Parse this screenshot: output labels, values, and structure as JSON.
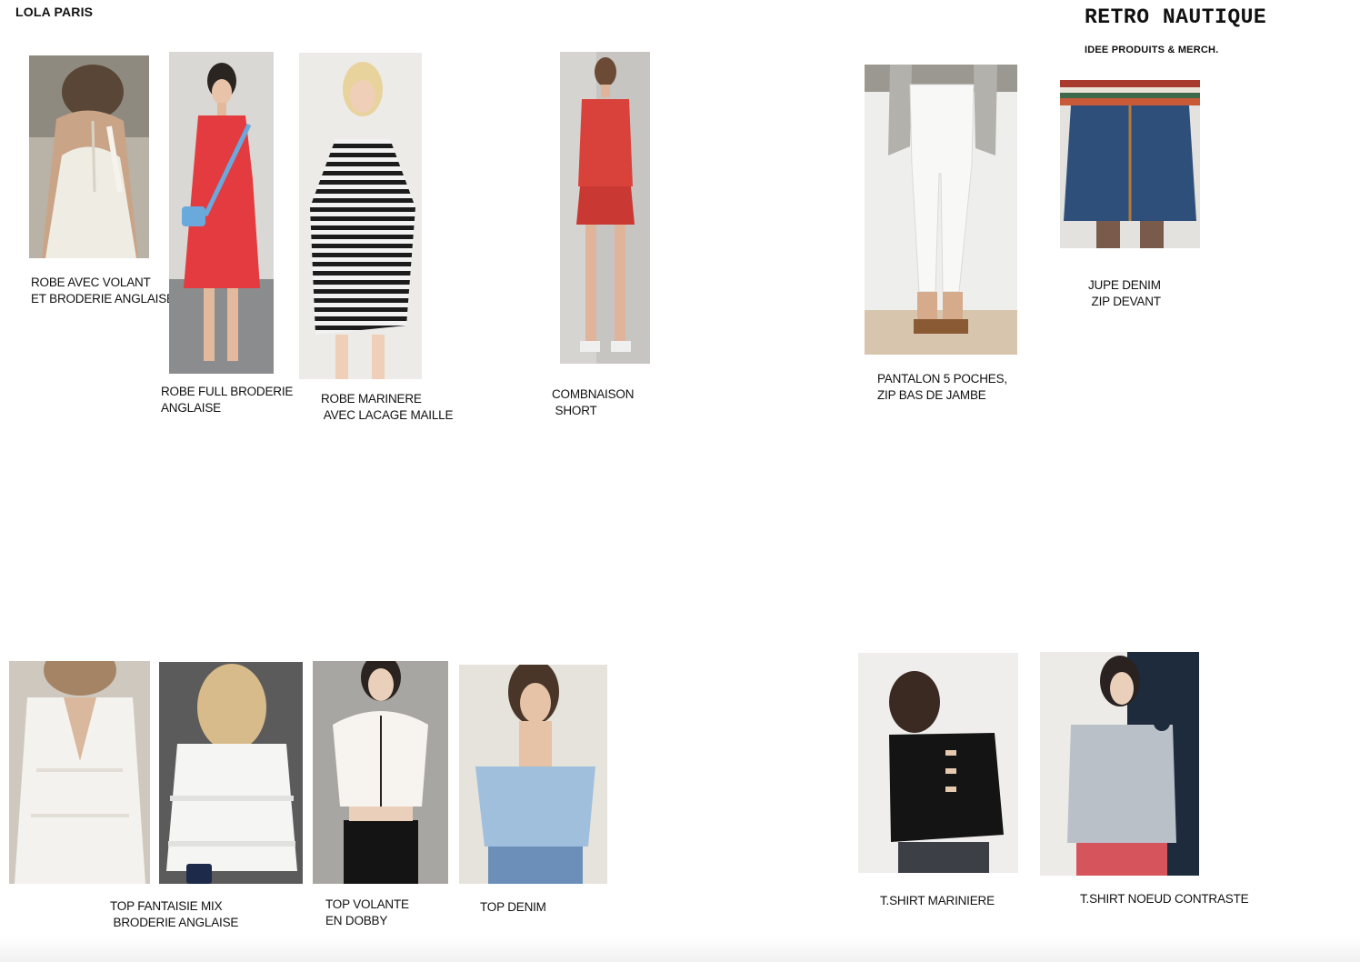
{
  "header": {
    "brand": "LOLA PARIS",
    "title": "RETRO NAUTIQUE",
    "subtitle": "IDEE PRODUITS & MERCH."
  },
  "products": [
    {
      "id": "robe-volant",
      "caption": "ROBE AVEC VOLANT\nET BRODERIE ANGLAISE"
    },
    {
      "id": "robe-broderie",
      "caption": "ROBE FULL BRODERIE\nANGLAISE"
    },
    {
      "id": "robe-mariniere",
      "caption": "ROBE MARINERE\n AVEC LACAGE MAILLE"
    },
    {
      "id": "combinaison-short",
      "caption": "COMBNAISON\n SHORT"
    },
    {
      "id": "pantalon",
      "caption": "PANTALON 5 POCHES,\nZIP BAS DE JAMBE"
    },
    {
      "id": "jupe-denim",
      "caption": "JUPE DENIM\n ZIP DEVANT"
    },
    {
      "id": "top-fantaisie",
      "caption": "TOP FANTAISIE MIX\n BRODERIE ANGLAISE"
    },
    {
      "id": "top-volante",
      "caption": "TOP VOLANTE\nEN DOBBY"
    },
    {
      "id": "top-denim",
      "caption": "TOP DENIM"
    },
    {
      "id": "tshirt-mariniere",
      "caption": "T.SHIRT MARINIERE"
    },
    {
      "id": "tshirt-noeud",
      "caption": "T.SHIRT NOEUD CONTRASTE"
    }
  ]
}
